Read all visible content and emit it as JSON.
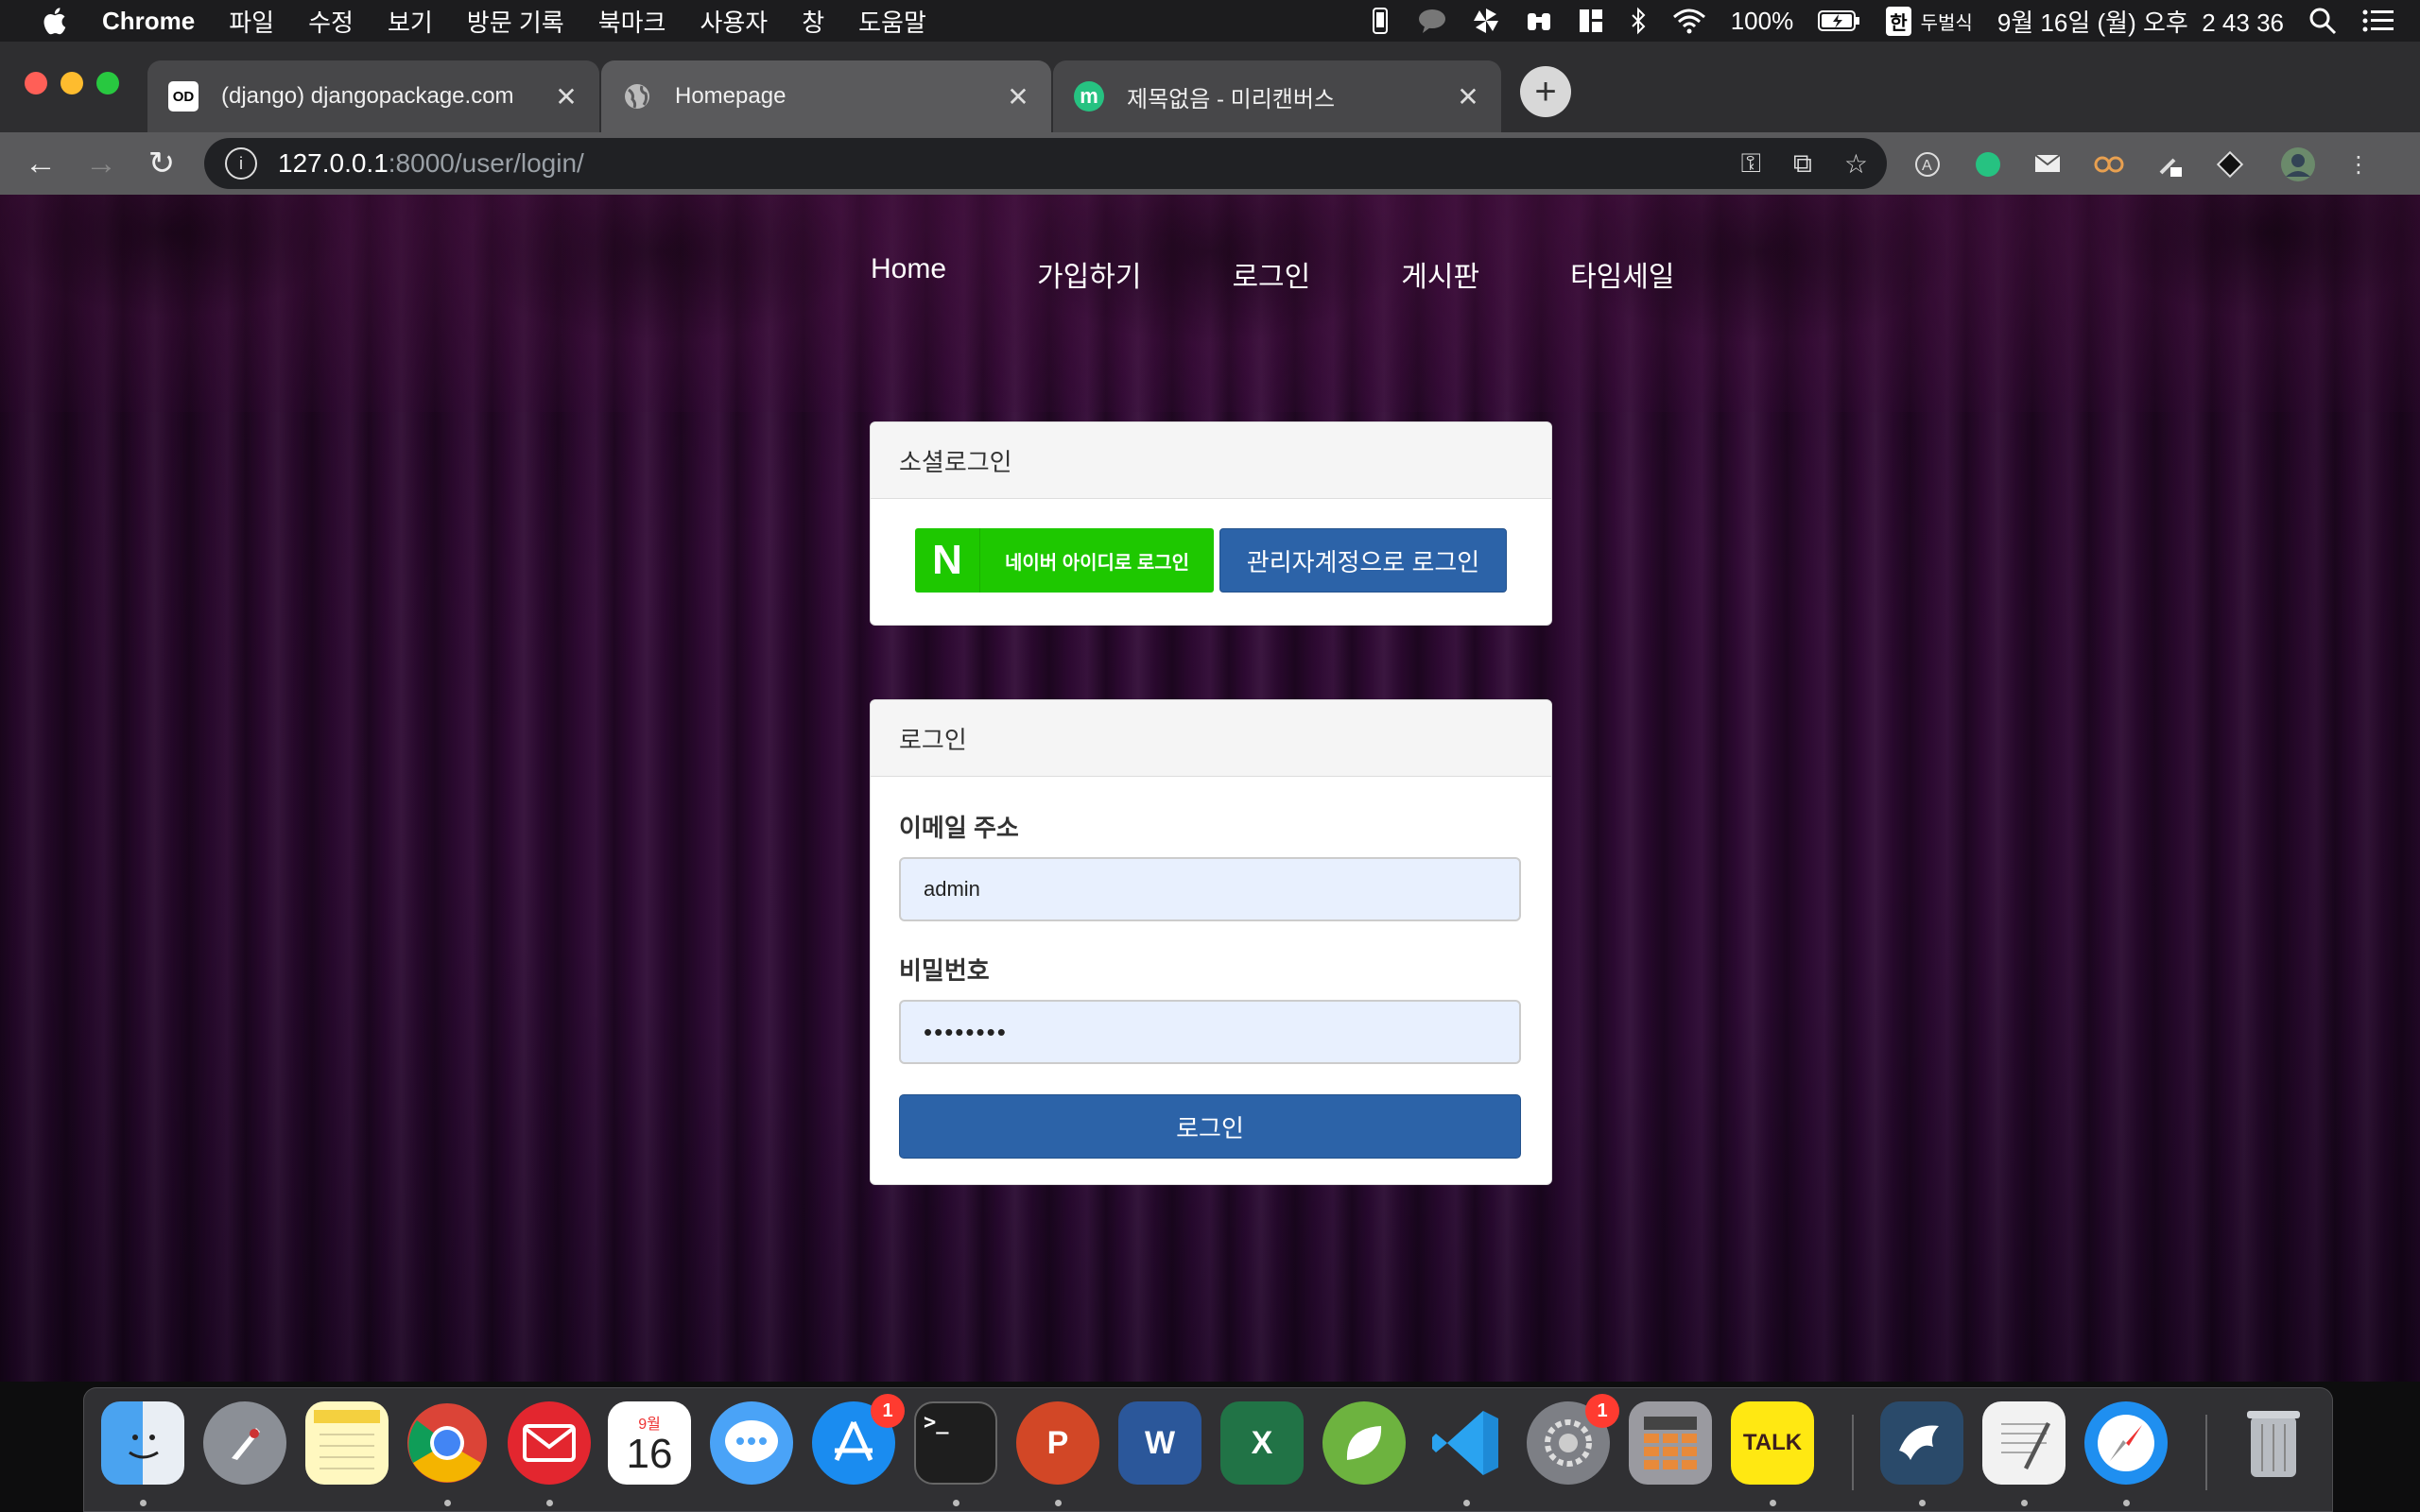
{
  "menubar": {
    "app_name": "Chrome",
    "items": [
      "파일",
      "수정",
      "보기",
      "방문 기록",
      "북마크",
      "사용자",
      "창",
      "도움말"
    ],
    "battery": "100%",
    "ime": "한",
    "ime_label": "두벌식",
    "datetime": "9월 16일 (월) 오후  2 43 36"
  },
  "tabs": [
    {
      "title": "(django) djangopackage.com",
      "favicon": "OD",
      "active": false
    },
    {
      "title": "Homepage",
      "favicon": "globe-icon",
      "active": true
    },
    {
      "title": "제목없음 - 미리캔버스",
      "favicon": "m",
      "active": false
    }
  ],
  "omnibox": {
    "url_host": "127.0.0.1",
    "url_rest": ":8000/user/login/"
  },
  "site_nav": [
    "Home",
    "가입하기",
    "로그인",
    "게시판",
    "타임세일"
  ],
  "social_login": {
    "header": "소셜로그인",
    "naver_logo": "N",
    "naver_label": "네이버 아이디로 로그인",
    "admin_label": "관리자계정으로 로그인"
  },
  "login_form": {
    "header": "로그인",
    "email_label": "이메일 주소",
    "email_value": "admin",
    "password_label": "비밀번호",
    "password_value": "••••••••",
    "submit_label": "로그인"
  },
  "dock": {
    "calendar_month": "9월",
    "calendar_day": "16",
    "appstore_badge": "1",
    "sysprefs_badge": "1",
    "kakao_label": "TALK"
  },
  "colors": {
    "naver_green": "#1ec800",
    "primary_blue": "#2c63a8",
    "input_bg": "#e8f0fe",
    "curtain": "#3a0d3c"
  }
}
